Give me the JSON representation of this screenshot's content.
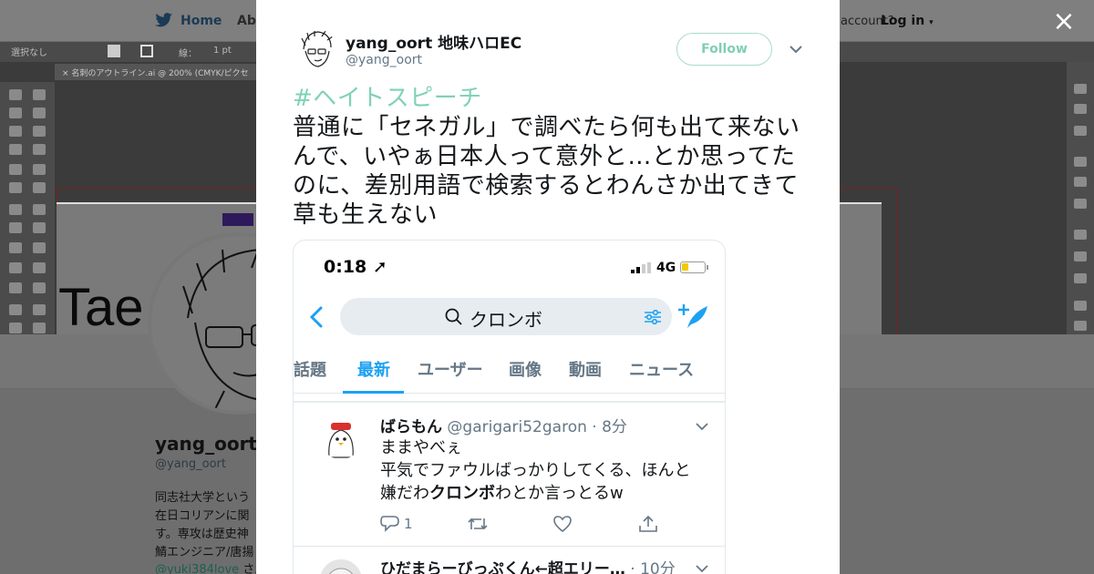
{
  "background": {
    "nav": {
      "home": "Home",
      "about": "Abo",
      "account_prompt": "account?",
      "login": "Log in"
    },
    "illustrator": {
      "toolbar_text": "選択なし",
      "stroke_label": "線：",
      "stroke_value": "1 pt",
      "doc_tab": "名刺のアウトライン.ai @ 200% (CMYK/ピクセ",
      "canvas_text": "Tae"
    },
    "profile": {
      "name": "yang_oort",
      "handle": "@yang_oort",
      "bio_lines": [
        "同志社大学という",
        "在日コリアンに関",
        "す。専攻は歴史神",
        "鯖エンジニア/唐揚"
      ],
      "mention": "@yuki384love",
      "mention_suffix": " さん"
    }
  },
  "modal": {
    "close_label": "×",
    "author": {
      "name": "yang_oort 地味ハロEC",
      "handle": "@yang_oort"
    },
    "follow_label": "Follow",
    "hashtag": "#ヘイトスピーチ",
    "text": "普通に「セネガル」で調べたら何も出て来ないんで、いやぁ日本人って意外と…とか思ってたのに、差別用語で検索するとわんさか出てきて草も生えない"
  },
  "screenshot": {
    "status": {
      "time": "0:18 ➚",
      "network": "4G"
    },
    "search_query": "クロンボ",
    "tabs": [
      "話題",
      "最新",
      "ユーザー",
      "画像",
      "動画",
      "ニュース"
    ],
    "active_tab": "最新",
    "tweets": [
      {
        "name": "ばらもん",
        "meta": " @garigari52garon · 8分",
        "line1": "ままやべぇ",
        "line2": "平気でファウルばっかりしてくる、ほんと",
        "line3_pre": "嫌だわ",
        "line3_bold": "クロンボ",
        "line3_post": "わとか言っとるw",
        "reply_count": "1"
      },
      {
        "name": "ひだまらーびっぷくん←超エリー…",
        "meta": " · 10分"
      }
    ]
  },
  "colors": {
    "twitter_blue": "#1da1f2",
    "hashtag_green": "#7fd3b3",
    "follow_border": "#a9dcc9",
    "overlay_gray": "#7d7d7d"
  },
  "icons": [
    "twitter-bird-icon",
    "close-icon",
    "chevron-down-icon",
    "back-icon",
    "search-icon",
    "filter-icon",
    "compose-icon",
    "reply-icon",
    "retweet-icon",
    "like-icon",
    "share-icon",
    "location-arrow-icon",
    "signal-icon",
    "battery-icon"
  ]
}
